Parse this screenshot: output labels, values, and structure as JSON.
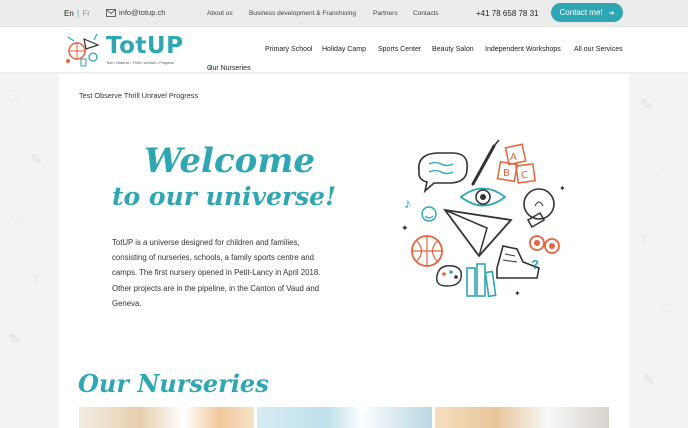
{
  "topbar": {
    "lang_active": "En",
    "lang_sep": "|",
    "lang_other": "Fr",
    "email": "info@totup.ch",
    "links": [
      "About us",
      "Business development & Franchising",
      "Partners",
      "Contacts"
    ],
    "phone": "+41 78 658 78 31",
    "contact_button": "Contact me!"
  },
  "brand": {
    "name": "TotUP",
    "tagline": "Test • Observe • Thrill • Unravel • Progress"
  },
  "nav": {
    "items": [
      "Our Nurseries",
      "Primary School",
      "Holiday Camp",
      "Sports Center",
      "Beauty Salon",
      "Independent Workshops",
      "All our Services"
    ],
    "dropdown_caret": "▾"
  },
  "hero": {
    "tagline": "Test Observe Thrill Unravel Progress",
    "welcome_line1": "Welcome",
    "welcome_line2": "to our universe!",
    "intro": "TotUP is a universe designed for children and families, consisting of nurseries, schools, a family sports centre and camps. The first nursery opened in Petit-Lancy in April 2018. Other projects are in the pipeline, in the Canton of Vaud and Geneva.",
    "illustration_letters": [
      "A",
      "B",
      "C"
    ]
  },
  "section": {
    "nurseries_title": "Our Nurseries"
  },
  "colors": {
    "accent": "#2fa6b3",
    "orange": "#e8623c",
    "dark": "#333333"
  }
}
